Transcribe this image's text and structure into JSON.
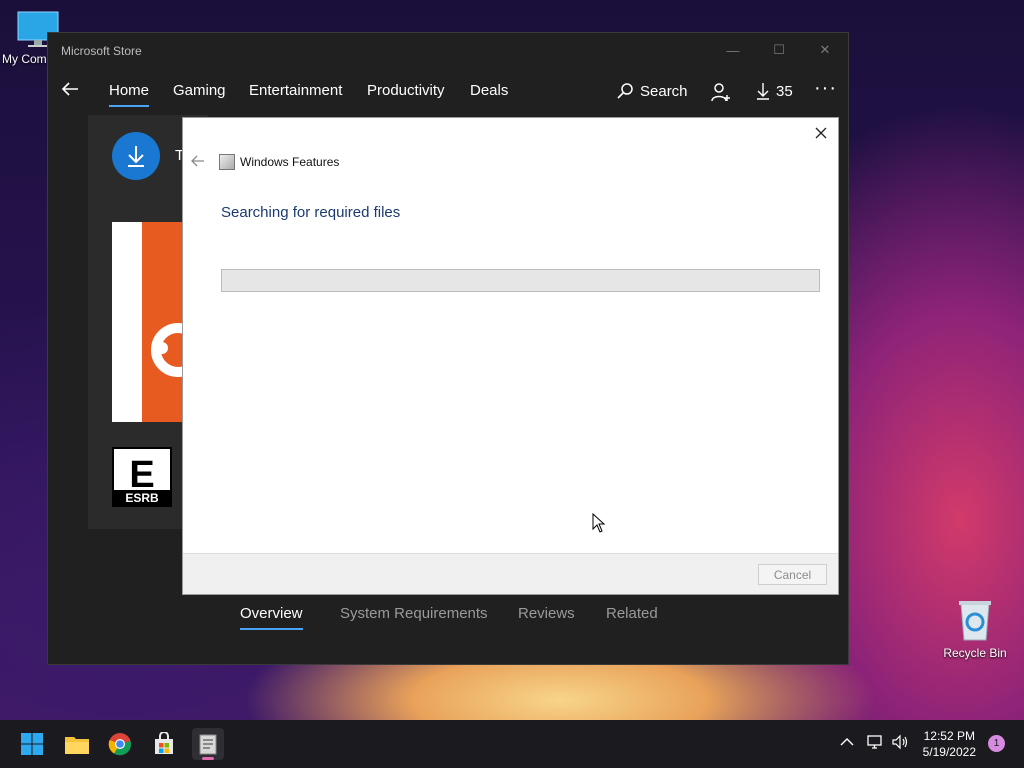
{
  "desktop": {
    "icons": [
      {
        "label": "My Com",
        "icon": "computer-icon"
      },
      {
        "label": "Recycle Bin",
        "icon": "recycle-bin-icon"
      }
    ]
  },
  "store": {
    "title": "Microsoft Store",
    "nav": {
      "items": [
        "Home",
        "Gaming",
        "Entertainment",
        "Productivity",
        "Deals"
      ],
      "active": "Home",
      "search_label": "Search",
      "downloads_count": "35"
    },
    "app_title_partial": "T",
    "rating_badge": "ESRB",
    "rating_letter": "E",
    "tabs": [
      "Overview",
      "System Requirements",
      "Reviews",
      "Related"
    ],
    "active_tab": "Overview"
  },
  "dialog": {
    "app_title": "Windows Features",
    "heading": "Searching for required files",
    "progress_fraction": 0.0,
    "cancel_label": "Cancel"
  },
  "taskbar": {
    "apps": [
      "start-icon",
      "file-explorer-icon",
      "chrome-icon",
      "store-icon",
      "windows-features-icon"
    ],
    "clock": {
      "time": "12:52 PM",
      "date": "5/19/2022"
    },
    "notification_count": "1"
  },
  "colors": {
    "accent": "#4aa3f5",
    "download_circle": "#1a78d2",
    "dialog_heading": "#1c3a6e"
  }
}
